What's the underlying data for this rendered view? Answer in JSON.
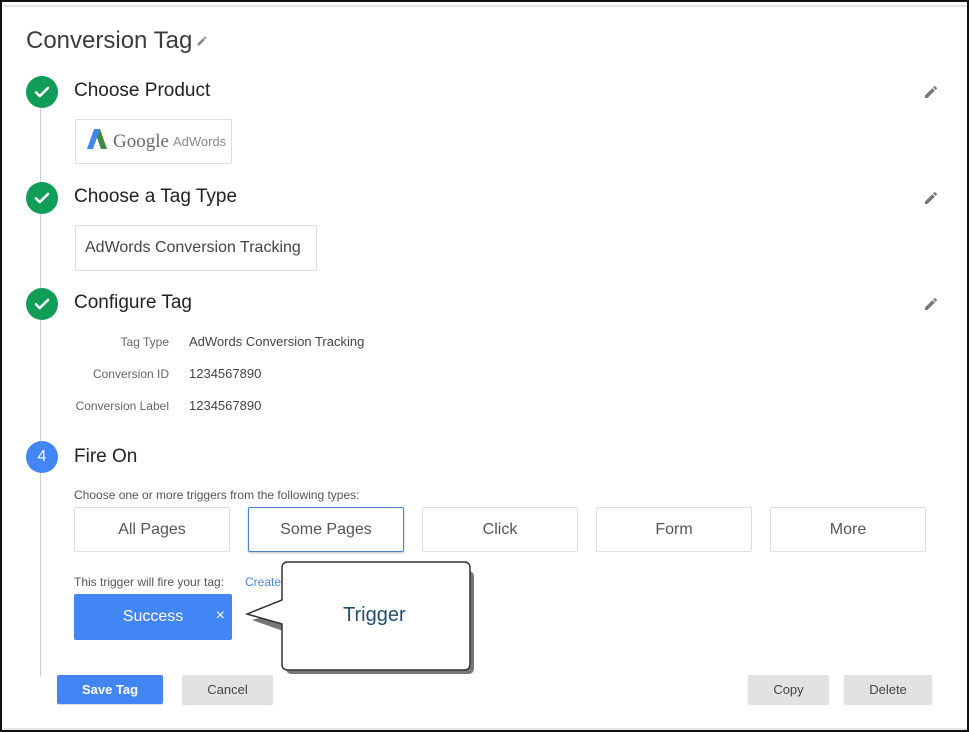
{
  "page": {
    "title": "Conversion Tag"
  },
  "steps": [
    {
      "number": "1",
      "title": "Choose Product",
      "status": "done"
    },
    {
      "number": "2",
      "title": "Choose a Tag Type",
      "status": "done"
    },
    {
      "number": "3",
      "title": "Configure Tag",
      "status": "done"
    },
    {
      "number": "4",
      "title": "Fire On",
      "status": "active"
    }
  ],
  "product": {
    "brand": "Google",
    "product": "AdWords"
  },
  "tag_type": {
    "value": "AdWords Conversion Tracking"
  },
  "configure": {
    "fields": [
      {
        "label": "Tag Type",
        "value": "AdWords Conversion Tracking"
      },
      {
        "label": "Conversion ID",
        "value": "1234567890"
      },
      {
        "label": "Conversion Label",
        "value": "1234567890"
      }
    ]
  },
  "fire_on": {
    "hint": "Choose one or more triggers from the following types:",
    "trigger_types": [
      "All Pages",
      "Some Pages",
      "Click",
      "Form",
      "More"
    ],
    "selected_type": "Some Pages",
    "fires_label": "This trigger will fire your tag:",
    "create_link": "Create",
    "selected_trigger": "Success",
    "remove_symbol": "×"
  },
  "callout": {
    "text": "Trigger"
  },
  "actions": {
    "save": "Save Tag",
    "cancel": "Cancel",
    "copy": "Copy",
    "delete": "Delete"
  },
  "colors": {
    "done": "#0f9d58",
    "active": "#4285f4",
    "primary_button": "#4285f4",
    "link": "#4a86e8"
  }
}
